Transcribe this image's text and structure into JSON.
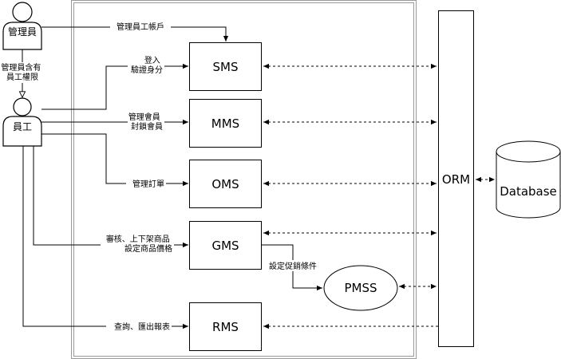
{
  "actors": {
    "admin": "管理員",
    "employee": "員工"
  },
  "inheritance_label": [
    "管理員含有",
    "員工權限"
  ],
  "modules": {
    "sms": "SMS",
    "mms": "MMS",
    "oms": "OMS",
    "gms": "GMS",
    "pmss": "PMSS",
    "rms": "RMS",
    "orm": "ORM",
    "database": "Database"
  },
  "edges": {
    "admin_to_sms": "管理員工帳戶",
    "employee_to_sms": [
      "登入",
      "驗證身分"
    ],
    "employee_to_mms": [
      "管理會員",
      "封鎖會員"
    ],
    "employee_to_oms": "管理訂單",
    "employee_to_gms": [
      "審核、上下架商品",
      "設定商品價格"
    ],
    "gms_to_pmss": "設定促銷條件",
    "employee_to_rms": "查詢、匯出報表"
  },
  "colors": {
    "stroke": "#000000",
    "container_stroke": "#999999",
    "fill": "#ffffff"
  }
}
